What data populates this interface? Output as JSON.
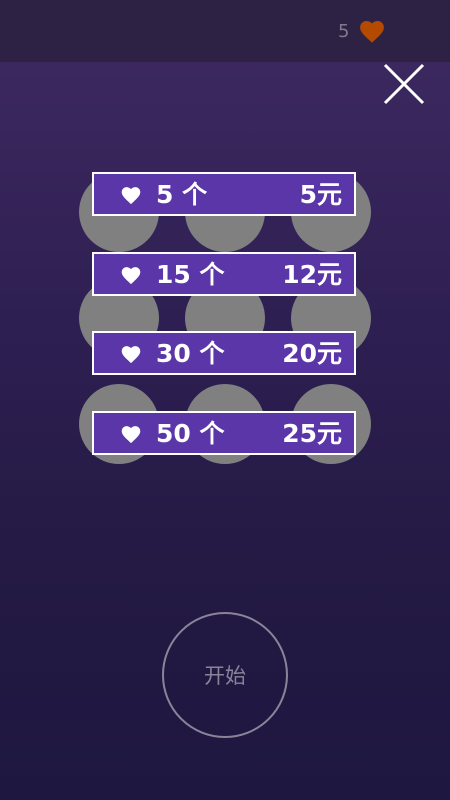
{
  "header": {
    "lives_count": "5",
    "lives_icon": "heart-icon",
    "close_icon": "close-icon"
  },
  "packs": [
    {
      "quantity": "5 个",
      "price": "5元"
    },
    {
      "quantity": "15 个",
      "price": "12元"
    },
    {
      "quantity": "30 个",
      "price": "20元"
    },
    {
      "quantity": "50 个",
      "price": "25元"
    }
  ],
  "start_button": {
    "label": "开始"
  },
  "colors": {
    "background_top": "#3f2a62",
    "background_bottom": "#1e1740",
    "pack_fill": "#5b36a8",
    "pack_border": "#ffffff",
    "lives_heart": "#b34a00",
    "circle_gray": "#808080"
  }
}
